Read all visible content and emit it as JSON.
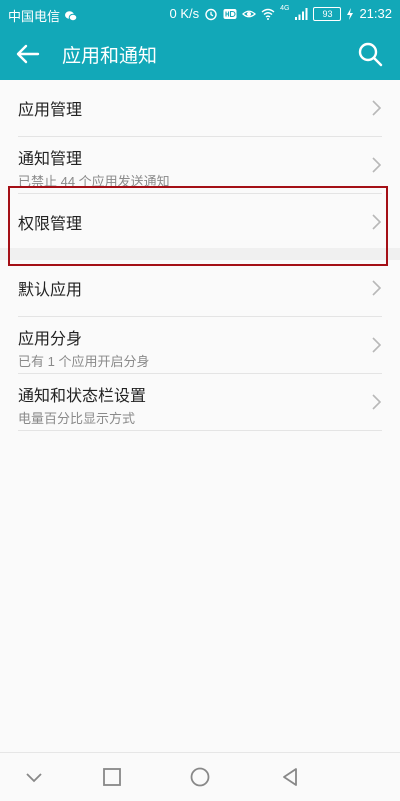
{
  "status_bar": {
    "carrier": "中国电信",
    "net_speed": "0 K/s",
    "network_type": "4G",
    "battery": "93",
    "time": "21:32",
    "icons": [
      "wechat-icon",
      "alarm-icon",
      "hd-icon",
      "eye-icon",
      "wifi-icon",
      "signal-icon",
      "battery-icon",
      "charging-icon"
    ]
  },
  "app_bar": {
    "title": "应用和通知",
    "back_icon": "arrow-left-icon",
    "search_icon": "search-icon",
    "color": "#12a8b8"
  },
  "settings": {
    "items": [
      {
        "title": "应用管理",
        "subtitle": ""
      },
      {
        "title": "通知管理",
        "subtitle": "已禁止 44 个应用发送通知"
      },
      {
        "title": "权限管理",
        "subtitle": ""
      },
      {
        "title": "默认应用",
        "subtitle": ""
      },
      {
        "title": "应用分身",
        "subtitle": "已有 1 个应用开启分身"
      },
      {
        "title": "通知和状态栏设置",
        "subtitle": "电量百分比显示方式"
      }
    ]
  },
  "highlight": {
    "color": "#a40f16"
  },
  "nav_bar": {
    "icons": [
      "chevron-down-icon",
      "square-icon",
      "circle-icon",
      "triangle-back-icon"
    ]
  }
}
